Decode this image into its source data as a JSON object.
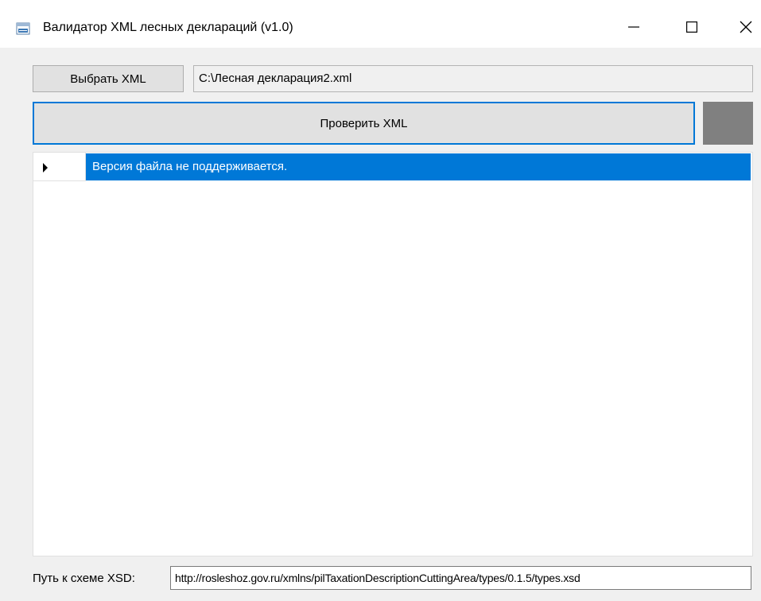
{
  "window": {
    "title": "Валидатор XML лесных деклараций (v1.0)",
    "icon": "xml-file-icon",
    "controls": {
      "minimize": "minimize-icon",
      "maximize": "maximize-icon",
      "close": "close-icon"
    }
  },
  "toolbar": {
    "select_label": "Выбрать XML",
    "file_path": "C:\\Лесная декларация2.xml",
    "check_label": "Проверить XML",
    "status_color": "#808080"
  },
  "results": {
    "rows": [
      {
        "message": "Версия файла не поддерживается."
      }
    ]
  },
  "footer": {
    "xsd_label": "Путь к схеме XSD:",
    "xsd_path": "http://rosleshoz.gov.ru/xmlns/pilTaxationDescriptionCuttingArea/types/0.1.5/types.xsd"
  },
  "colors": {
    "accent": "#0078d7",
    "selection_text": "#ffffff"
  }
}
